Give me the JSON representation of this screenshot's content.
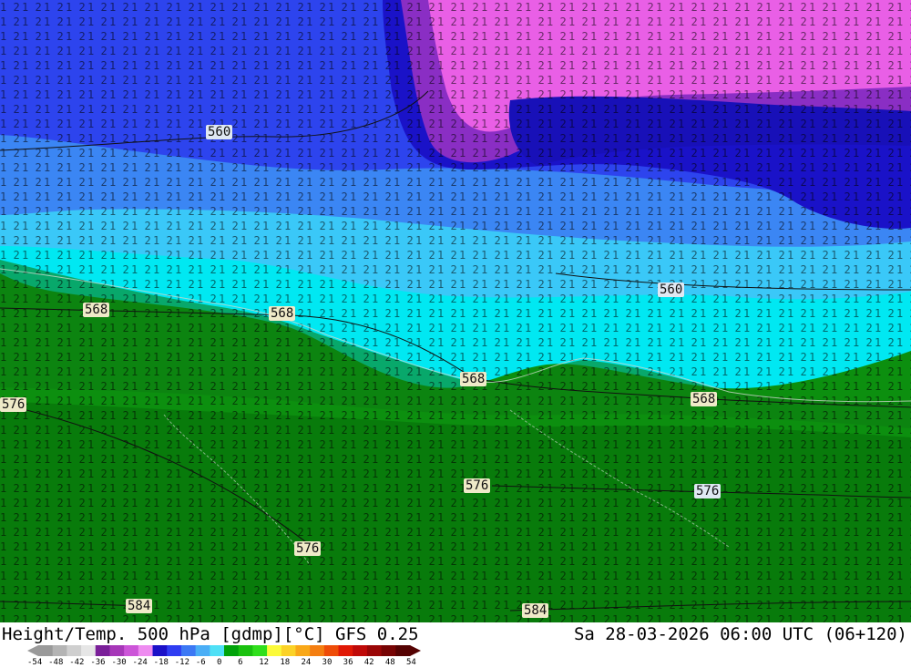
{
  "map": {
    "labels": [
      "560",
      "560",
      "568",
      "568",
      "568",
      "568",
      "576",
      "576",
      "576",
      "576",
      "584",
      "584"
    ]
  },
  "footer": {
    "title_left": "Height/Temp. 500 hPa [gdmp][°C] GFS 0.25",
    "title_right": "Sa 28-03-2026 06:00 UTC (06+120)"
  },
  "colorbar": {
    "ticks": [
      "-54",
      "-48",
      "-42",
      "-36",
      "-30",
      "-24",
      "-18",
      "-12",
      "-6",
      "0",
      "6",
      "12",
      "18",
      "24",
      "30",
      "36",
      "42",
      "48",
      "54"
    ],
    "colors": [
      "#9a9a9a",
      "#b4b4b4",
      "#cfcfcf",
      "#e6e6e6",
      "#7a1f99",
      "#a637b8",
      "#cc55d8",
      "#ee8cf0",
      "#1b10c8",
      "#2f3df2",
      "#3c78f4",
      "#4aaef6",
      "#4fe0f6",
      "#00a30a",
      "#1ac10f",
      "#30df1c",
      "#fbfa3a",
      "#fbd227",
      "#f9a818",
      "#f47e10",
      "#ee4c08",
      "#e01805",
      "#bf0a08",
      "#9a0606",
      "#770404",
      "#550202"
    ]
  }
}
